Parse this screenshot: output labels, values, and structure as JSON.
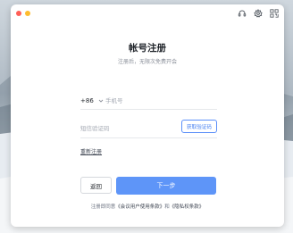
{
  "window": {
    "title": "帐号注册",
    "subtitle": "注册后，无限次免费开会"
  },
  "toolbar": {
    "icons": [
      "headset-icon",
      "gear-icon",
      "qr-code-icon"
    ]
  },
  "form": {
    "phone": {
      "country_code": "+86",
      "placeholder": "手机号",
      "value": ""
    },
    "code": {
      "placeholder": "短信验证码",
      "value": "",
      "get_code_label": "获取验证码"
    },
    "reregister_label": "重新注册"
  },
  "buttons": {
    "back_label": "返回",
    "next_label": "下一步"
  },
  "agreement": {
    "prefix": "注册即同意",
    "user_agreement": "《会议用户使用条款》",
    "conjunction": "和",
    "privacy_policy": "《隐私权条款》"
  },
  "colors": {
    "accent": "#5e95f8",
    "link_blue": "#3f7bf0",
    "traffic_red": "#ff5f57",
    "traffic_yellow": "#febc2e"
  }
}
